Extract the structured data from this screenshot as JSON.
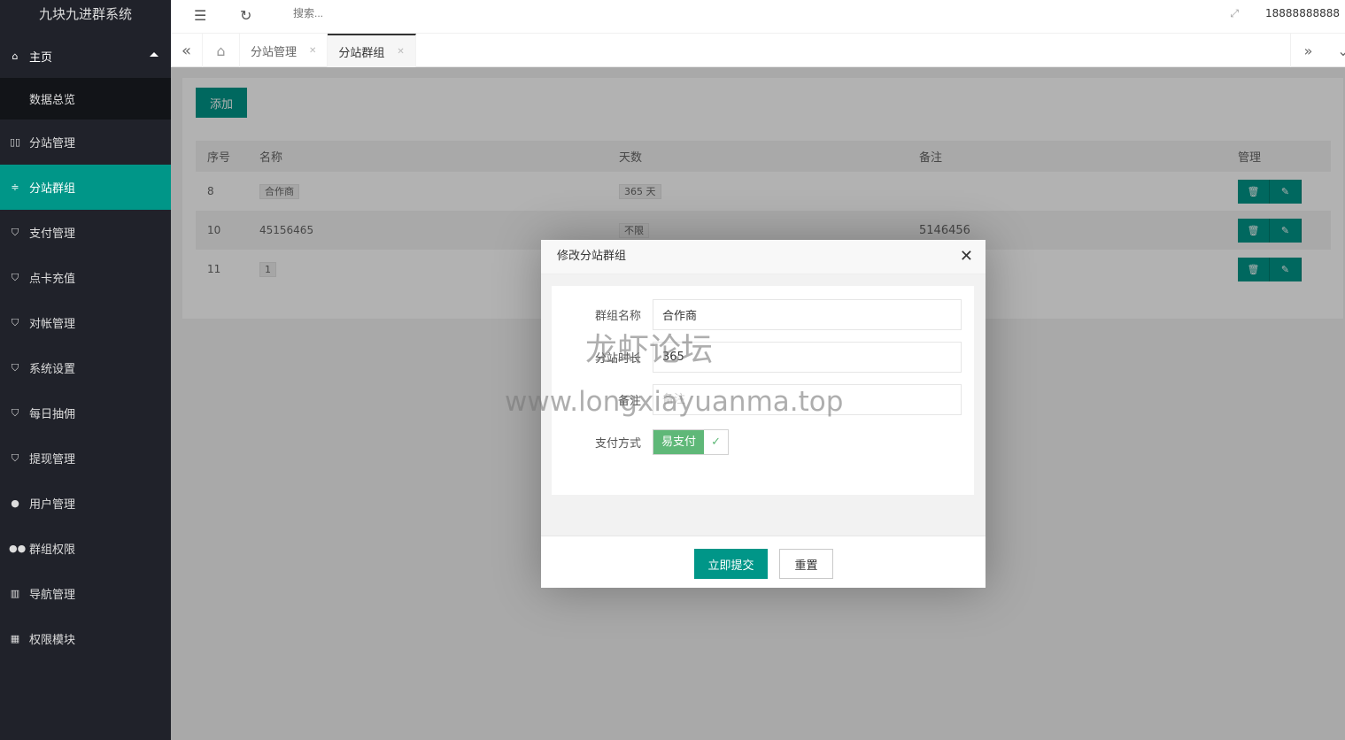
{
  "app_title": "九块九进群系统",
  "sidebar": {
    "items": [
      {
        "label": "主页",
        "icon": "home-icon"
      },
      {
        "label": "数据总览",
        "icon": ""
      },
      {
        "label": "分站管理",
        "icon": "columns-icon"
      },
      {
        "label": "分站群组",
        "icon": "sliders-icon"
      },
      {
        "label": "支付管理",
        "icon": "shield-icon"
      },
      {
        "label": "点卡充值",
        "icon": "shield-icon"
      },
      {
        "label": "对帐管理",
        "icon": "shield-icon"
      },
      {
        "label": "系统设置",
        "icon": "shield-icon"
      },
      {
        "label": "每日抽佣",
        "icon": "shield-icon"
      },
      {
        "label": "提现管理",
        "icon": "shield-icon"
      },
      {
        "label": "用户管理",
        "icon": "user-icon"
      },
      {
        "label": "群组权限",
        "icon": "users-icon"
      },
      {
        "label": "导航管理",
        "icon": "chart-icon"
      },
      {
        "label": "权限模块",
        "icon": "grid-icon"
      }
    ]
  },
  "header": {
    "search_placeholder": "搜索...",
    "user": "18888888888"
  },
  "tabs": [
    {
      "label": "分站管理"
    },
    {
      "label": "分站群组"
    }
  ],
  "main": {
    "add_label": "添加",
    "columns": [
      "序号",
      "名称",
      "天数",
      "备注",
      "管理"
    ],
    "rows": [
      {
        "id": "8",
        "name": "合作商",
        "days": "365 天",
        "note": ""
      },
      {
        "id": "10",
        "name": "45156465",
        "days": "不限",
        "note": "5146456"
      },
      {
        "id": "11",
        "name": "1",
        "days": "",
        "note": ""
      }
    ]
  },
  "modal": {
    "title": "修改分站群组",
    "fields": [
      {
        "label": "群组名称",
        "value": "合作商",
        "placeholder": ""
      },
      {
        "label": "分站时长",
        "value": "365",
        "placeholder": ""
      },
      {
        "label": "备注",
        "value": "",
        "placeholder": "备注"
      }
    ],
    "pay_label": "支付方式",
    "pay_option": "易支付",
    "pay_checked": true,
    "submit": "立即提交",
    "reset": "重置"
  },
  "watermark": {
    "line1": "龙虾论坛",
    "line2": "www.longxiayuanma.top"
  },
  "colors": {
    "accent": "#009688",
    "sidebar": "#20222a",
    "checkbox": "#5fb878"
  }
}
